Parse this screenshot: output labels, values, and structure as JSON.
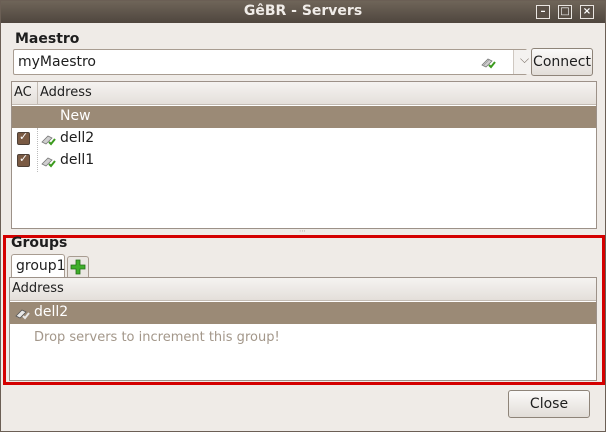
{
  "window": {
    "title": "GêBR - Servers"
  },
  "titlebar_icons": {
    "minimize": "minimize-icon",
    "maximize": "maximize-icon",
    "close": "close-icon"
  },
  "maestro": {
    "label": "Maestro",
    "value": "myMaestro",
    "status_icon": "server-connected-icon",
    "dropdown_icon": "chevron-down-icon",
    "connect_label": "Connect"
  },
  "servers": {
    "columns": [
      "AC",
      "Address"
    ],
    "new_row": "New",
    "rows": [
      {
        "address": "dell2",
        "autoconnect": true
      },
      {
        "address": "dell1",
        "autoconnect": true
      }
    ]
  },
  "groups": {
    "label": "Groups",
    "tabs": [
      {
        "label": "group1"
      }
    ],
    "add_tab_icon": "add-icon",
    "column": "Address",
    "members": [
      {
        "address": "dell2"
      }
    ],
    "hint": "Drop servers to increment this group!"
  },
  "footer": {
    "close_label": "Close"
  },
  "colors": {
    "selection": "#9b8a76",
    "highlight_frame": "#d40000",
    "check": "#7a5a43"
  }
}
